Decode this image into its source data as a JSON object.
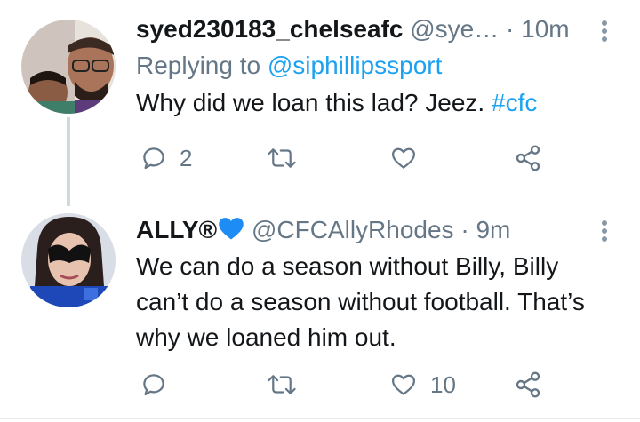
{
  "colors": {
    "link": "#1da1f2",
    "secondary_text": "#657786",
    "primary_text": "#14171a",
    "heart_badge": "#1d8df5",
    "thread_line": "#cfd9de"
  },
  "tweets": [
    {
      "display_name": "syed230183_chelseafc",
      "handle": "@sye…",
      "separator": "·",
      "time": "10m",
      "replying_label": "Replying to",
      "replying_to": "@siphillipssport",
      "text": "Why did we loan this lad? Jeez.",
      "hashtag": "#cfc",
      "reply_count": "2",
      "retweet_count": "",
      "like_count": "",
      "icons": [
        "reply-icon",
        "retweet-icon",
        "like-icon",
        "share-icon",
        "more-options-icon"
      ]
    },
    {
      "display_name": "ALLY®",
      "handle": "@CFCAllyRhodes",
      "separator": "·",
      "time": "9m",
      "text": "We can do a season without Billy, Billy\ncan’t do a season without football. That’s\nwhy we loaned him out.",
      "reply_count": "",
      "retweet_count": "",
      "like_count": "10",
      "icons": [
        "reply-icon",
        "retweet-icon",
        "like-icon",
        "share-icon",
        "more-options-icon",
        "blue-heart-icon"
      ]
    }
  ]
}
